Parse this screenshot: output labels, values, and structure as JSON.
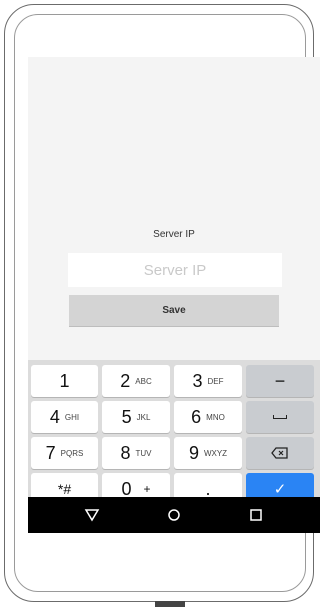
{
  "settings": {
    "label": "Server IP",
    "input_placeholder": "Server IP",
    "input_value": "",
    "save_label": "Save"
  },
  "keyboard": {
    "keys": [
      {
        "main": "1",
        "sub": ""
      },
      {
        "main": "2",
        "sub": "ABC"
      },
      {
        "main": "3",
        "sub": "DEF"
      },
      {
        "main": "−",
        "sub": ""
      },
      {
        "main": "4",
        "sub": "GHI"
      },
      {
        "main": "5",
        "sub": "JKL"
      },
      {
        "main": "6",
        "sub": "MNO"
      },
      {
        "main": "␣",
        "sub": ""
      },
      {
        "main": "7",
        "sub": "PQRS"
      },
      {
        "main": "8",
        "sub": "TUV"
      },
      {
        "main": "9",
        "sub": "WXYZ"
      },
      {
        "main": "⌫",
        "sub": ""
      },
      {
        "main": "*#",
        "sub": ""
      },
      {
        "main": "0",
        "sub": "+"
      },
      {
        "main": ".",
        "sub": ""
      },
      {
        "main": "✓",
        "sub": ""
      }
    ]
  },
  "nav": {
    "back_icon": "triangle-back-icon",
    "home_icon": "circle-home-icon",
    "recents_icon": "square-recents-icon"
  },
  "colors": {
    "accent": "#2a84f4",
    "keyboard_bg": "#dcdcdc",
    "screen_bg": "#f4f4f4"
  }
}
